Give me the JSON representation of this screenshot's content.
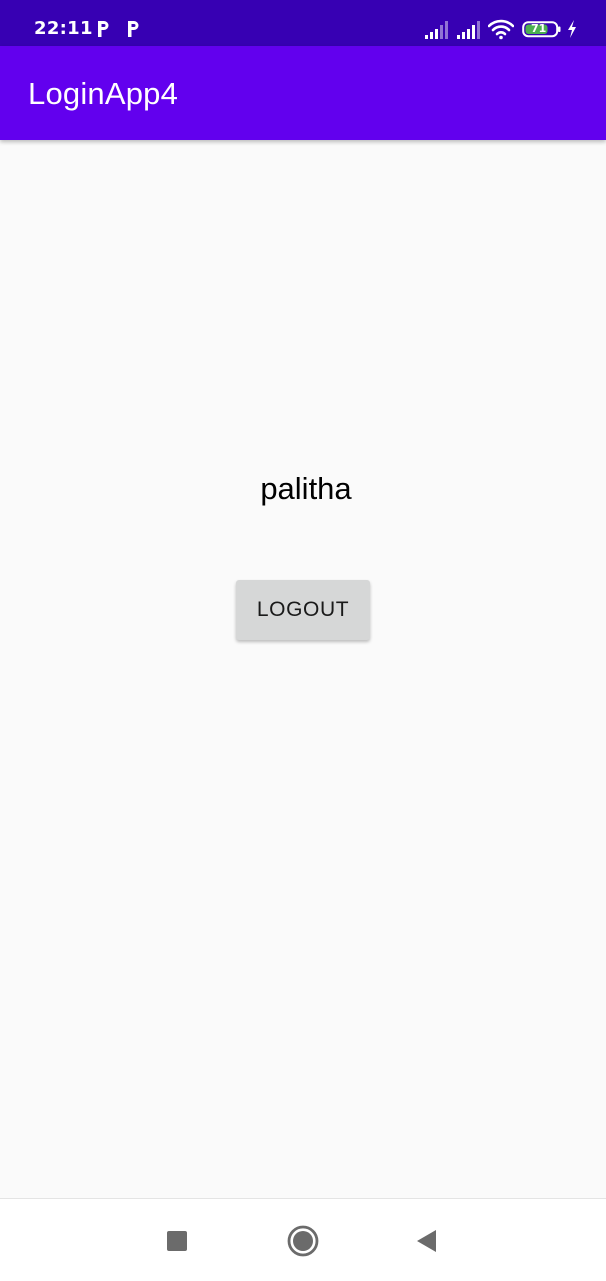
{
  "status_bar": {
    "time": "22:11",
    "notification_icons": [
      "parking-p-icon",
      "parking-p-icon"
    ],
    "battery_level": "71",
    "icons": [
      "signal-icon",
      "signal-icon",
      "wifi-icon",
      "battery-icon",
      "charging-bolt-icon"
    ],
    "background_color": "#3700b3"
  },
  "app_bar": {
    "title": "LoginApp4",
    "background_color": "#6200ee"
  },
  "main": {
    "username": "palitha",
    "logout_label": "LOGOUT",
    "button_color": "#d6d7d7"
  },
  "nav_bar": {
    "buttons": [
      "recents-square-icon",
      "home-circle-icon",
      "back-triangle-icon"
    ]
  }
}
